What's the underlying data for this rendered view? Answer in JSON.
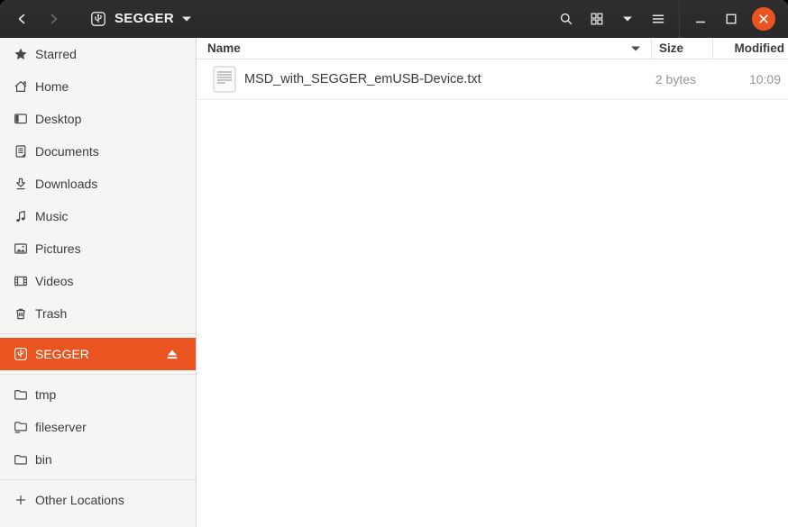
{
  "titlebar": {
    "location_label": "SEGGER",
    "icons": {
      "back": "chevron-left",
      "forward": "chevron-right",
      "location_device": "usb-drive",
      "location_caret": "caret-down",
      "search": "magnifier",
      "view_grid": "grid-squares",
      "view_caret": "caret-down",
      "menu": "hamburger",
      "minimize": "underscore",
      "maximize": "square-outline",
      "close": "circle-x"
    }
  },
  "sidebar": {
    "items": [
      {
        "label": "Starred",
        "icon": "star"
      },
      {
        "label": "Home",
        "icon": "house"
      },
      {
        "label": "Desktop",
        "icon": "desktop"
      },
      {
        "label": "Documents",
        "icon": "document"
      },
      {
        "label": "Downloads",
        "icon": "down-arrow"
      },
      {
        "label": "Music",
        "icon": "music-note"
      },
      {
        "label": "Pictures",
        "icon": "photo"
      },
      {
        "label": "Videos",
        "icon": "film"
      },
      {
        "label": "Trash",
        "icon": "trash-can"
      }
    ],
    "device": {
      "label": "SEGGER",
      "icon": "usb-drive",
      "selected": true,
      "action_icon": "eject"
    },
    "mounts": [
      {
        "label": "tmp",
        "icon": "folder"
      },
      {
        "label": "fileserver",
        "icon": "folder-remote"
      },
      {
        "label": "bin",
        "icon": "folder"
      }
    ],
    "other_locations": {
      "label": "Other Locations",
      "icon": "plus"
    }
  },
  "main": {
    "columns": [
      {
        "label": "Name"
      },
      {
        "label": "Size"
      },
      {
        "label": "Modified"
      }
    ],
    "files": [
      {
        "name": "MSD_with_SEGGER_emUSB-Device.txt",
        "size": "2 bytes",
        "modified": "10:09",
        "icon": "text-file"
      }
    ]
  },
  "colors": {
    "accent": "#E95420",
    "titlebar_bg": "#2C2A2A",
    "sidebar_bg": "#F6F5F4",
    "selection_text": "#FFFFFF",
    "muted_text": "#979594"
  }
}
